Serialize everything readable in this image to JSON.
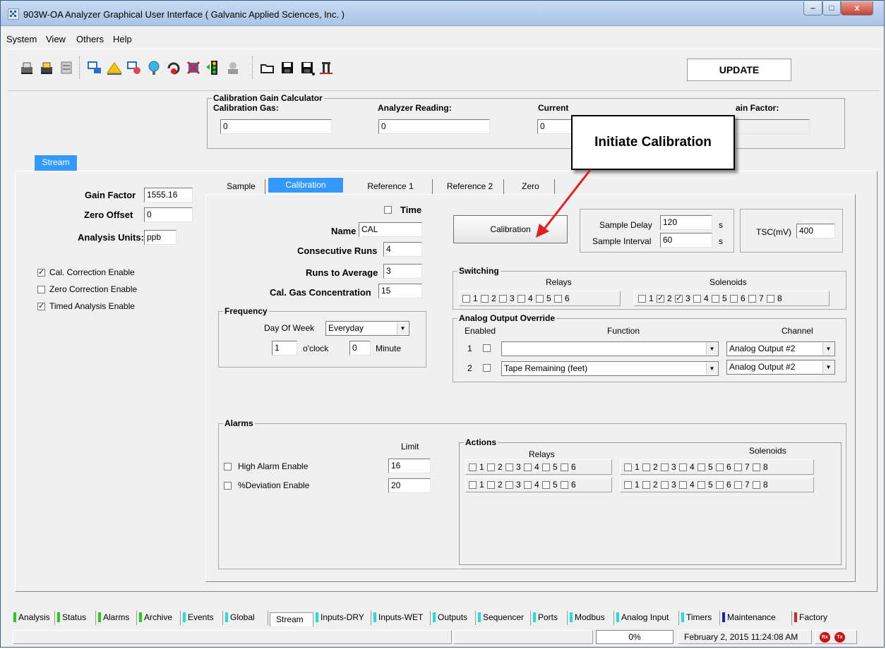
{
  "window": {
    "title": "903W-OA Analyzer Graphical User Interface  ( Galvanic Applied Sciences, Inc. )",
    "minimize_label": "–",
    "maximize_label": "□",
    "close_label": "x"
  },
  "menu": [
    {
      "label": "System"
    },
    {
      "label": "View"
    },
    {
      "label": "Others"
    },
    {
      "label": "Help"
    }
  ],
  "toolbar": {
    "update_label": "UPDATE",
    "icons": [
      "print-icon",
      "print-preview-icon",
      "printer-setup-icon",
      "connect-icon",
      "sun-icon",
      "disconnect-icon",
      "network-icon",
      "reset-icon",
      "stop-icon",
      "traffic-light-icon",
      "user-icon",
      "open-folder-icon",
      "save-icon",
      "save-as-icon",
      "chart-icon"
    ]
  },
  "calibration_gain_calculator": {
    "title": "Calibration Gain Calculator",
    "calibration_gas_label": "Calibration Gas:",
    "calibration_gas_value": "0",
    "analyzer_reading_label": "Analyzer Reading:",
    "analyzer_reading_value": "0",
    "current_gain_label": "Current",
    "current_gain_value": "0",
    "new_gain_label": "ain Factor:",
    "new_gain_value": ""
  },
  "callout": {
    "text": "Initiate Calibration"
  },
  "stream_tab": {
    "label": "Stream"
  },
  "left_panel": {
    "gain_factor_label": "Gain Factor",
    "gain_factor_value": "1555.16",
    "zero_offset_label": "Zero Offset",
    "zero_offset_value": "0",
    "analysis_units_label": "Analysis Units:",
    "analysis_units_value": "ppb",
    "checks": [
      {
        "label": "Cal. Correction Enable",
        "checked": true
      },
      {
        "label": "Zero Correction Enable",
        "checked": false
      },
      {
        "label": "Timed Analysis Enable",
        "checked": true
      }
    ]
  },
  "tabs": [
    {
      "label": "Sample",
      "active": false
    },
    {
      "label": "Calibration",
      "active": true
    },
    {
      "label": "Reference 1",
      "active": false
    },
    {
      "label": "Reference 2",
      "active": false
    },
    {
      "label": "Zero",
      "active": false
    }
  ],
  "calibration": {
    "time_label": "Time",
    "name_label": "Name",
    "name_value": "CAL",
    "consecutive_runs_label": "Consecutive Runs",
    "consecutive_runs_value": "4",
    "runs_to_average_label": "Runs to Average",
    "runs_to_average_value": "3",
    "cal_gas_conc_label": "Cal. Gas Concentration",
    "cal_gas_conc_value": "15",
    "calibration_button": "Calibration",
    "sample_delay_label": "Sample Delay",
    "sample_delay_value": "120",
    "sample_delay_unit": "s",
    "sample_interval_label": "Sample Interval",
    "sample_interval_value": "60",
    "sample_interval_unit": "s",
    "tsc_label": "TSC(mV)",
    "tsc_value": "400"
  },
  "frequency": {
    "title": "Frequency",
    "day_of_week_label": "Day Of Week",
    "day_of_week_value": "Everyday",
    "hour_value": "1",
    "hour_label": "o'clock",
    "minute_value": "0",
    "minute_label": "Minute"
  },
  "switching": {
    "title": "Switching",
    "relays_label": "Relays",
    "solenoids_label": "Solenoids",
    "relays": [
      {
        "n": "1",
        "checked": false
      },
      {
        "n": "2",
        "checked": false
      },
      {
        "n": "3",
        "checked": false
      },
      {
        "n": "4",
        "checked": false
      },
      {
        "n": "5",
        "checked": false
      },
      {
        "n": "6",
        "checked": false
      }
    ],
    "solenoids": [
      {
        "n": "1",
        "checked": false
      },
      {
        "n": "2",
        "checked": true
      },
      {
        "n": "3",
        "checked": true
      },
      {
        "n": "4",
        "checked": false
      },
      {
        "n": "5",
        "checked": false
      },
      {
        "n": "6",
        "checked": false
      },
      {
        "n": "7",
        "checked": false
      },
      {
        "n": "8",
        "checked": false
      }
    ]
  },
  "analog_output_override": {
    "title": "Analog Output Override",
    "enabled_label": "Enabled",
    "function_label": "Function",
    "channel_label": "Channel",
    "rows": [
      {
        "index": "1",
        "enabled": false,
        "function": "",
        "channel": "Analog Output #2"
      },
      {
        "index": "2",
        "enabled": false,
        "function": "Tape Remaining (feet)",
        "channel": "Analog Output #2"
      }
    ]
  },
  "alarms": {
    "title": "Alarms",
    "limit_label": "Limit",
    "high_alarm_label": "High Alarm Enable",
    "high_alarm_limit": "16",
    "deviation_label": "%Deviation Enable",
    "deviation_limit": "20",
    "actions_title": "Actions",
    "relays_label": "Relays",
    "solenoids_label": "Solenoids",
    "relay_numbers": [
      "1",
      "2",
      "3",
      "4",
      "5",
      "6"
    ],
    "solenoid_numbers": [
      "1",
      "2",
      "3",
      "4",
      "5",
      "6",
      "7",
      "8"
    ]
  },
  "bottom_tabs": [
    {
      "label": "Analysis",
      "color": "#22cc22"
    },
    {
      "label": "Status",
      "color": "#22cc22"
    },
    {
      "label": "Alarms",
      "color": "#22cc22"
    },
    {
      "label": "Archive",
      "color": "#22cc22"
    },
    {
      "label": "Events",
      "color": "#22dddd"
    },
    {
      "label": "Global",
      "color": "#22dddd"
    },
    {
      "label": "Stream",
      "color": "",
      "active": true
    },
    {
      "label": "Inputs-DRY",
      "color": "#22dddd"
    },
    {
      "label": "Inputs-WET",
      "color": "#22dddd"
    },
    {
      "label": "Outputs",
      "color": "#22dddd"
    },
    {
      "label": "Sequencer",
      "color": "#22dddd"
    },
    {
      "label": "Ports",
      "color": "#22dddd"
    },
    {
      "label": "Modbus",
      "color": "#22dddd"
    },
    {
      "label": "Analog Input",
      "color": "#22dddd"
    },
    {
      "label": "Timers",
      "color": "#22dddd"
    },
    {
      "label": "Maintenance",
      "color": "#1122cc"
    },
    {
      "label": "Factory",
      "color": "#dd2222"
    }
  ],
  "status": {
    "progress": "0%",
    "datetime": "February 2, 2015 11:24:08 AM",
    "rx_label": "Rx",
    "tx_label": "Tx"
  }
}
